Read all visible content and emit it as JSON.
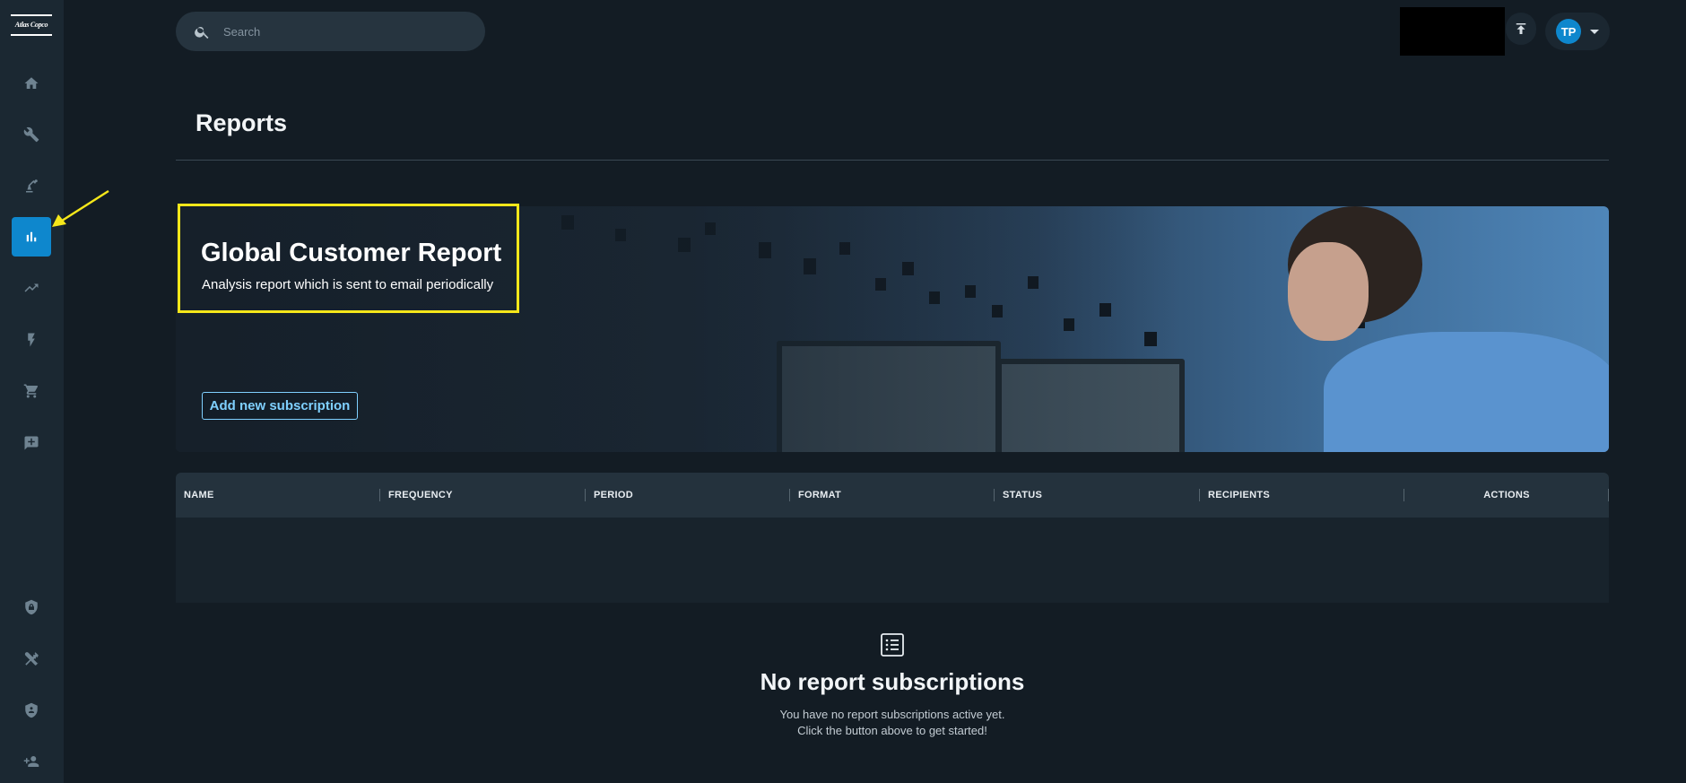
{
  "brand": {
    "logo_text": "Atlas Copco",
    "accent_color": "#0e87cd",
    "highlight_color": "#f5e71a"
  },
  "sidebar": {
    "items": [
      {
        "name": "home",
        "icon": "home-icon",
        "active": false
      },
      {
        "name": "service",
        "icon": "wrench-icon",
        "active": false
      },
      {
        "name": "machines",
        "icon": "robot-arm-icon",
        "active": false
      },
      {
        "name": "reports",
        "icon": "bar-chart-icon",
        "active": true
      },
      {
        "name": "trends",
        "icon": "trending-up-icon",
        "active": false
      },
      {
        "name": "energy",
        "icon": "bolt-icon",
        "active": false
      },
      {
        "name": "shop",
        "icon": "cart-icon",
        "active": false
      },
      {
        "name": "feedback",
        "icon": "add-comment-icon",
        "active": false
      }
    ],
    "bottom_items": [
      {
        "name": "security-settings",
        "icon": "shield-lock-icon"
      },
      {
        "name": "tools",
        "icon": "tools-icon"
      },
      {
        "name": "privacy",
        "icon": "shield-icon"
      },
      {
        "name": "add-user",
        "icon": "person-add-icon"
      }
    ]
  },
  "header": {
    "search": {
      "placeholder": "Search"
    },
    "user": {
      "initials": "TP"
    }
  },
  "page": {
    "title": "Reports"
  },
  "banner": {
    "title": "Global Customer Report",
    "subtitle": "Analysis report which is sent to email periodically",
    "button_label": "Add new subscription"
  },
  "table": {
    "columns": [
      "NAME",
      "FREQUENCY",
      "PERIOD",
      "FORMAT",
      "STATUS",
      "RECIPIENTS",
      "ACTIONS"
    ]
  },
  "empty_state": {
    "icon": "list-icon",
    "title": "No report subscriptions",
    "line1": "You have no report subscriptions active yet.",
    "line2": "Click the button above to get started!"
  }
}
